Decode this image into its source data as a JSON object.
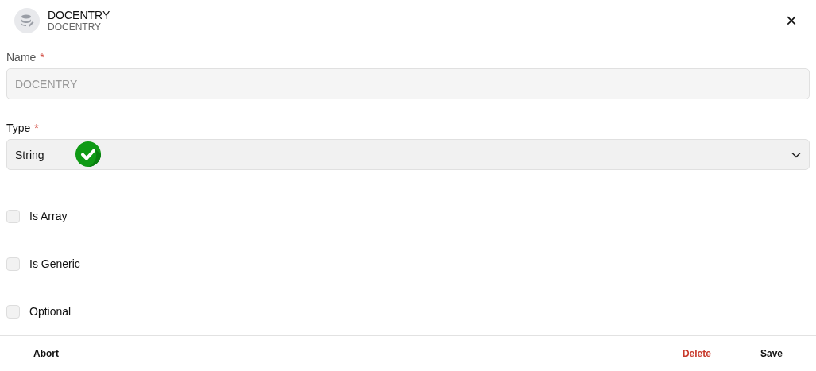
{
  "header": {
    "title": "DOCENTRY",
    "subtitle": "DOCENTRY",
    "close": "×"
  },
  "fields": [
    {
      "label": "Name",
      "required_mark": "*",
      "kind": "text",
      "value": "DOCENTRY",
      "disabled": true
    },
    {
      "label": "Type",
      "required_mark": "*",
      "kind": "select",
      "value": "String",
      "disabled": false,
      "valid": true
    }
  ],
  "options": [
    {
      "label": "Is Array",
      "checked": false
    },
    {
      "label": "Is Generic",
      "checked": false
    },
    {
      "label": "Optional",
      "checked": false
    }
  ],
  "buttons": [
    {
      "label": "Abort",
      "kind": "neutral"
    },
    {
      "label": "Delete",
      "kind": "danger"
    },
    {
      "label": "Save",
      "kind": "neutral"
    }
  ]
}
